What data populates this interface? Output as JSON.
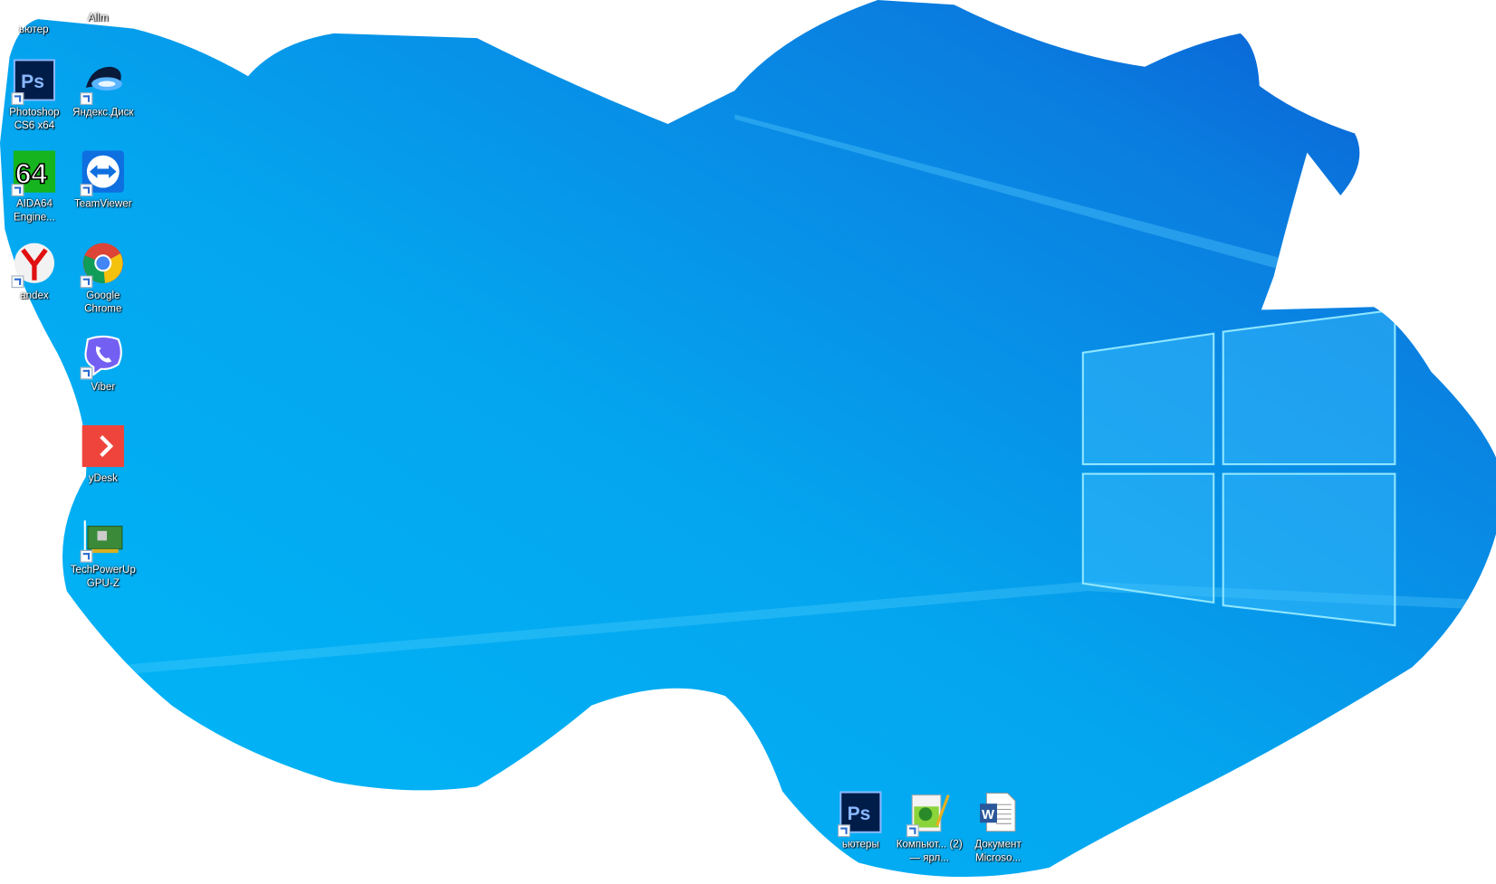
{
  "desktop": {
    "colors": {
      "wallpaper_light": "#00b4f5",
      "wallpaper_dark": "#0a5fd6",
      "logo_pane": "#3fc2ff",
      "outside": "#ffffff"
    },
    "top_labels": [
      "ьютер",
      "Allm"
    ],
    "icons": [
      {
        "label": "Photoshop CS6 x64",
        "icon": "photoshop-icon"
      },
      {
        "label": "Яндекс.Диск",
        "icon": "yandex-disk-icon"
      },
      {
        "label": "AIDA64 Engine...",
        "icon": "aida64-icon"
      },
      {
        "label": "TeamViewer",
        "icon": "teamviewer-icon"
      },
      {
        "label": "andex",
        "icon": "yandex-browser-icon"
      },
      {
        "label": "Google Chrome",
        "icon": "chrome-icon"
      },
      {
        "label": "Viber",
        "icon": "viber-icon"
      },
      {
        "label": "yDesk",
        "icon": "anydesk-icon"
      },
      {
        "label": "TechPowerUp GPU-Z",
        "icon": "gpuz-icon"
      }
    ],
    "bottom_icons": [
      {
        "label": "ьютеры",
        "icon": "photoshop-icon"
      },
      {
        "label": "Компьют... (2) — ярл...",
        "icon": "notepadpp-icon"
      },
      {
        "label": "Документ Microso...",
        "icon": "word-document-icon"
      }
    ]
  }
}
